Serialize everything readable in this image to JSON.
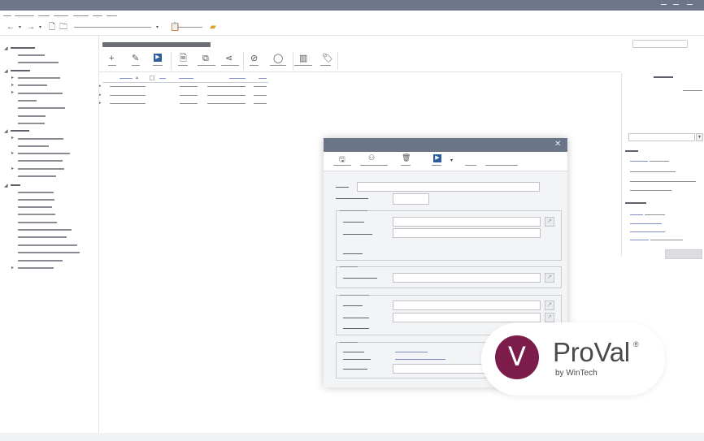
{
  "window": {
    "minimize_glyph": "",
    "maximize_glyph": "",
    "close_glyph": ""
  },
  "toolbar": {
    "back_icon": "arrow-left",
    "forward_icon": "arrow-right",
    "new_icon": "document",
    "open_icon": "folder",
    "dropdown_icon": "chevron-down"
  },
  "ribbon": {
    "items": [
      "add-icon",
      "edit-icon",
      "run-icon",
      "report-icon",
      "copy-icon",
      "share-icon",
      "hide-icon",
      "view-icon",
      "columns-icon",
      "tag-icon"
    ]
  },
  "dialog": {
    "close_label": "✕",
    "tools": [
      "save-icon",
      "people-icon",
      "delete-icon",
      "run-icon"
    ]
  },
  "badge": {
    "product": "ProVal",
    "registered": "®",
    "byline": "by WinTech",
    "logo_letter": "V"
  },
  "colors": {
    "titlebar": "#6d7789",
    "brand": "#7b1c4b",
    "link": "#7d8fc6"
  }
}
